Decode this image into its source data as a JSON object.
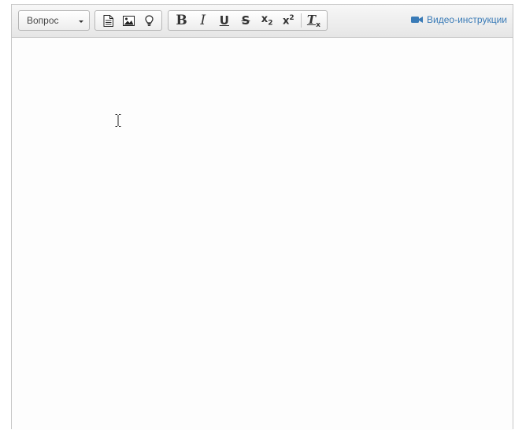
{
  "toolbar": {
    "format_select": {
      "value": "Вопрос"
    },
    "insert_group": {
      "items": [
        {
          "name": "document-icon"
        },
        {
          "name": "image-icon"
        },
        {
          "name": "lightbulb-icon"
        }
      ]
    },
    "format_group": {
      "bold": "B",
      "italic": "I",
      "underline": "U",
      "strikethrough": "S",
      "subscript_base": "x",
      "subscript_mark": "2",
      "superscript_base": "x",
      "superscript_mark": "2",
      "clear_base": "T",
      "clear_mark": "x"
    },
    "video_link": {
      "label": "Видео-инструкции",
      "icon": "video-camera-icon",
      "color": "#3a7bb7"
    }
  },
  "editor": {
    "content": ""
  }
}
